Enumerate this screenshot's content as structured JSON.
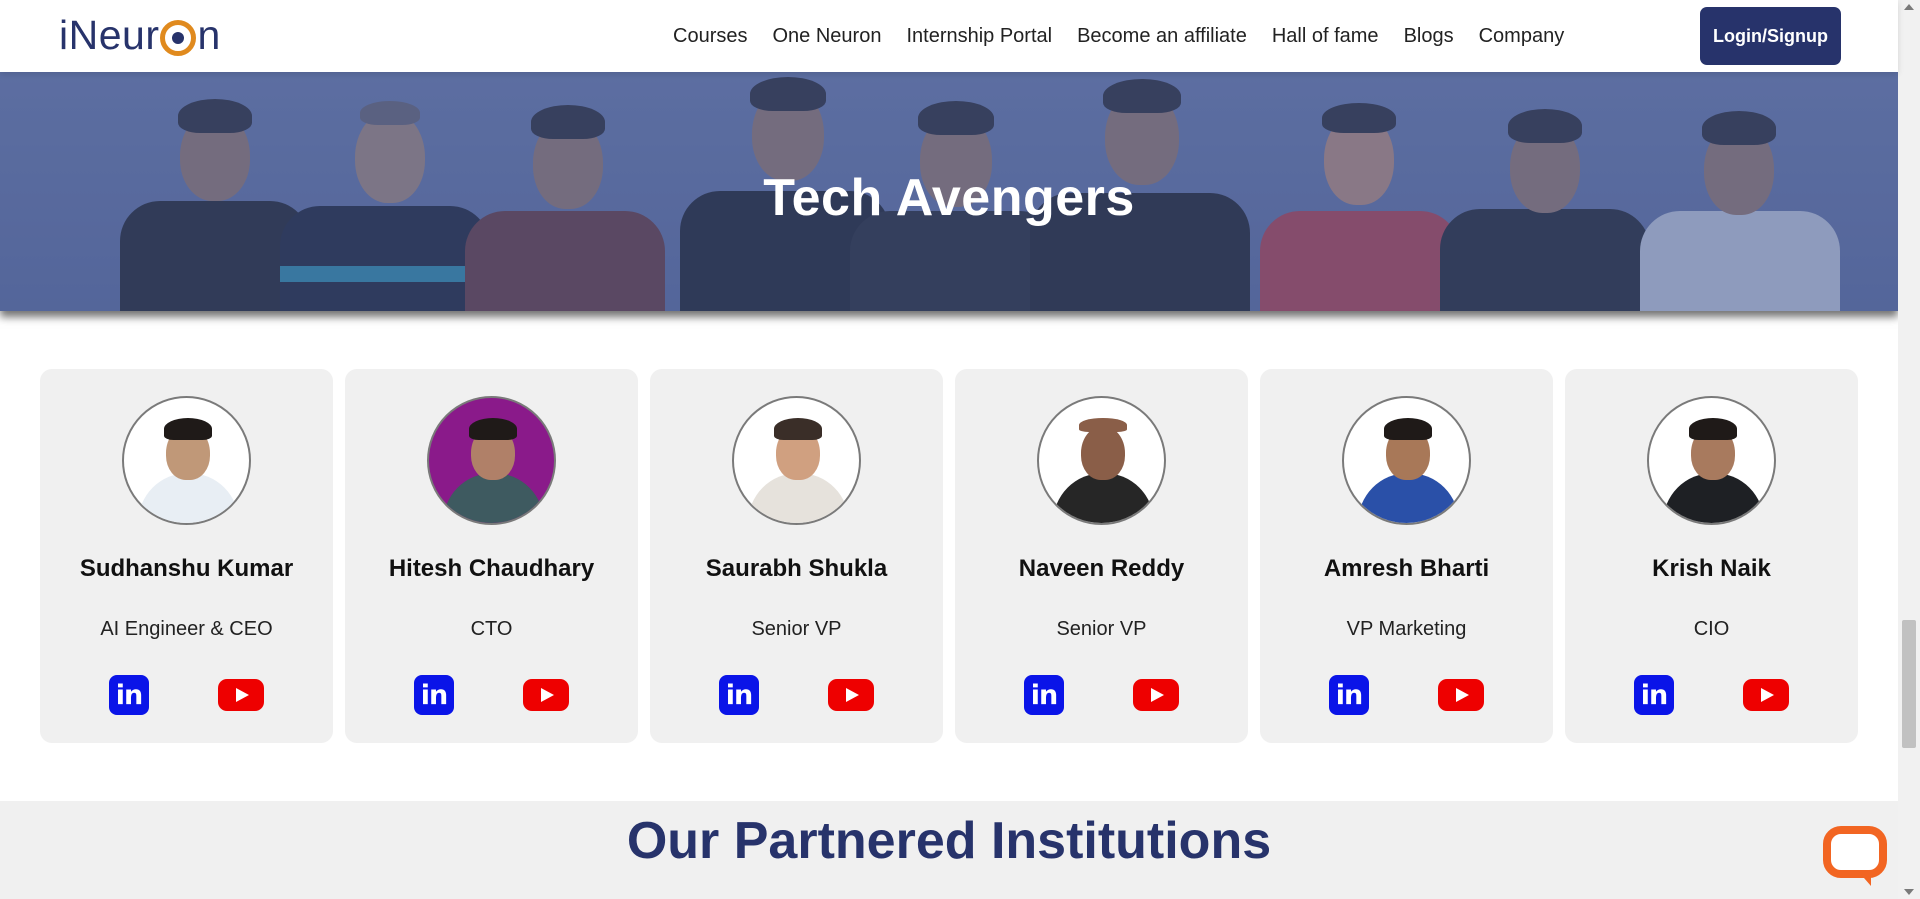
{
  "header": {
    "logo_text_left": "iNeur",
    "logo_text_right": "n",
    "nav": [
      "Courses",
      "One Neuron",
      "Internship Portal",
      "Become an affiliate",
      "Hall of fame",
      "Blogs",
      "Company"
    ],
    "login_label": "Login/Signup"
  },
  "hero": {
    "title": "Tech Avengers"
  },
  "team": [
    {
      "name": "Sudhanshu Kumar",
      "role": "AI Engineer & CEO",
      "linkedin_icon": "in"
    },
    {
      "name": "Hitesh Chaudhary",
      "role": "CTO",
      "linkedin_icon": "in"
    },
    {
      "name": "Saurabh Shukla",
      "role": "Senior VP",
      "linkedin_icon": "in"
    },
    {
      "name": "Naveen Reddy",
      "role": "Senior VP",
      "linkedin_icon": "in"
    },
    {
      "name": "Amresh Bharti",
      "role": "VP Marketing",
      "linkedin_icon": "in"
    },
    {
      "name": "Krish Naik",
      "role": "CIO",
      "linkedin_icon": "in"
    }
  ],
  "partners": {
    "title": "Our Partnered Institutions"
  },
  "colors": {
    "brand": "#27336b",
    "accent": "#e08a1e",
    "linkedin": "#0a14e8",
    "youtube": "#ee0000",
    "chat": "#f26522"
  },
  "icons": {
    "chat": "chat-bubble-icon",
    "linkedin": "linkedin-icon",
    "youtube": "youtube-icon"
  }
}
